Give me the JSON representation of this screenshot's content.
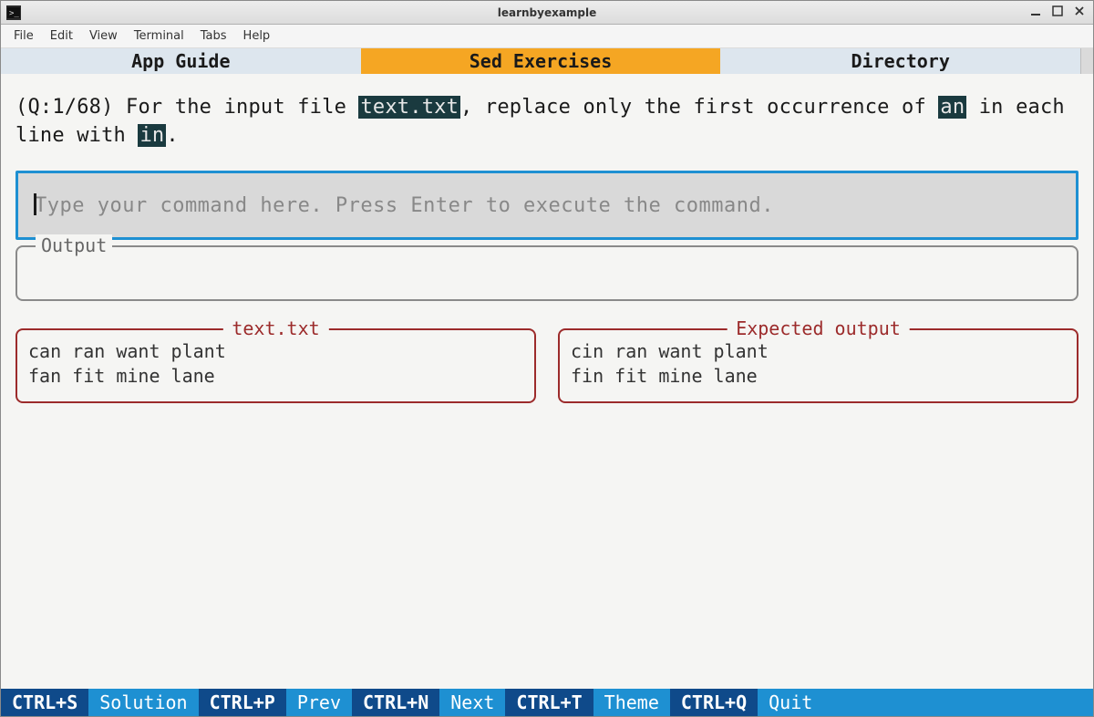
{
  "window": {
    "title": "learnbyexample"
  },
  "menubar": [
    "File",
    "Edit",
    "View",
    "Terminal",
    "Tabs",
    "Help"
  ],
  "tabs": {
    "items": [
      "App Guide",
      "Sed Exercises",
      "Directory"
    ],
    "active_index": 1
  },
  "question": {
    "prefix": "(Q:1/68) For the input file ",
    "file_token": "text.txt",
    "mid1": ", replace only the first occurrence of ",
    "token_an": "an",
    "mid2": " in each line with ",
    "token_in": "in",
    "suffix": "."
  },
  "command_input": {
    "placeholder": "Type your command here. Press Enter to execute the command."
  },
  "output": {
    "label": "Output"
  },
  "input_file": {
    "label": "text.txt",
    "content": "can ran want plant\nfan fit mine lane"
  },
  "expected": {
    "label": "Expected output",
    "content": "cin ran want plant\nfin fit mine lane"
  },
  "footer": [
    {
      "key": "CTRL+S",
      "label": "Solution"
    },
    {
      "key": "CTRL+P",
      "label": "Prev"
    },
    {
      "key": "CTRL+N",
      "label": "Next"
    },
    {
      "key": "CTRL+T",
      "label": "Theme"
    },
    {
      "key": "CTRL+Q",
      "label": "Quit"
    }
  ]
}
